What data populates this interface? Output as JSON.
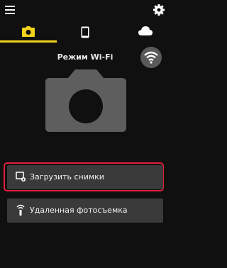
{
  "header": {
    "menu_icon": "hamburger-menu-icon",
    "settings_icon": "gear-icon"
  },
  "tabs": [
    {
      "name": "camera",
      "icon": "camera-icon",
      "active": true
    },
    {
      "name": "smartphone",
      "icon": "smartphone-icon",
      "active": false
    },
    {
      "name": "cloud",
      "icon": "cloud-icon",
      "active": false
    }
  ],
  "main": {
    "title": "Режим Wi-Fi",
    "wifi_icon": "wifi-icon",
    "actions": [
      {
        "label": "Загрузить снимки",
        "icon": "download-to-device-icon",
        "highlighted": true
      },
      {
        "label": "Удаленная фотосъемка",
        "icon": "remote-shutter-icon",
        "highlighted": false
      }
    ]
  },
  "colors": {
    "accent": "#f2d21c",
    "highlight": "#e51e3a",
    "background": "#101010",
    "row": "#3a3a3a"
  }
}
